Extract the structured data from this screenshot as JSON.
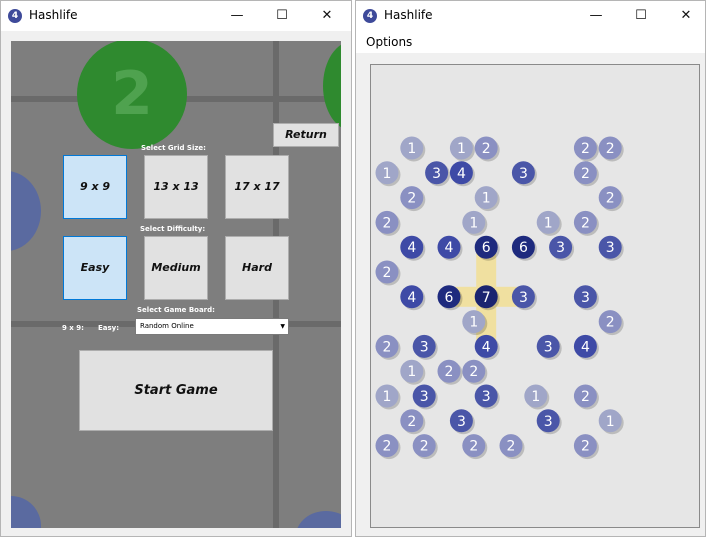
{
  "app_icon_text": "4",
  "left_window": {
    "title": "Hashlife",
    "controls": {
      "minimize": "—",
      "maximize": "☐",
      "close": "✕"
    },
    "return_label": "Return",
    "select_grid_size_label": "Select Grid Size:",
    "grid_sizes": [
      "9 x 9",
      "13 x 13",
      "17 x 17"
    ],
    "select_difficulty_label": "Select Difficulty:",
    "difficulties": [
      "Easy",
      "Medium",
      "Hard"
    ],
    "select_board_label": "Select Game Board:",
    "current_size": "9 x 9:",
    "current_difficulty": "Easy:",
    "board_dropdown_value": "Random Online",
    "start_label": "Start Game",
    "background_circle_number": "2"
  },
  "right_window": {
    "title": "Hashlife",
    "controls": {
      "minimize": "—",
      "maximize": "☐",
      "close": "✕"
    },
    "menu": [
      "Options"
    ]
  },
  "colors": {
    "node_1": "#a0a6c8",
    "node_2": "#8a90c2",
    "node_3": "#4a56a8",
    "node_4": "#3e4aa6",
    "node_6": "#1e2a7e",
    "node_7": "#1a2470",
    "bridge_highlight": "#f0e0a0",
    "selected_button": "#cce4f7"
  },
  "board": {
    "nodes": [
      {
        "n": "1",
        "c": 2,
        "r": 0
      },
      {
        "n": "1",
        "c": 6,
        "r": 0
      },
      {
        "n": "2",
        "c": 8,
        "r": 0
      },
      {
        "n": "2",
        "c": 16,
        "r": 0
      },
      {
        "n": "2",
        "c": 18,
        "r": 0
      },
      {
        "n": "1",
        "c": 0,
        "r": 1
      },
      {
        "n": "3",
        "c": 4,
        "r": 1
      },
      {
        "n": "4",
        "c": 6,
        "r": 1
      },
      {
        "n": "3",
        "c": 11,
        "r": 1
      },
      {
        "n": "2",
        "c": 16,
        "r": 1
      },
      {
        "n": "2",
        "c": 2,
        "r": 2
      },
      {
        "n": "1",
        "c": 8,
        "r": 2
      },
      {
        "n": "2",
        "c": 18,
        "r": 2
      },
      {
        "n": "2",
        "c": 0,
        "r": 3
      },
      {
        "n": "1",
        "c": 7,
        "r": 3
      },
      {
        "n": "1",
        "c": 13,
        "r": 3
      },
      {
        "n": "2",
        "c": 16,
        "r": 3
      },
      {
        "n": "4",
        "c": 2,
        "r": 4
      },
      {
        "n": "4",
        "c": 5,
        "r": 4
      },
      {
        "n": "6",
        "c": 8,
        "r": 4
      },
      {
        "n": "6",
        "c": 11,
        "r": 4
      },
      {
        "n": "3",
        "c": 14,
        "r": 4
      },
      {
        "n": "3",
        "c": 18,
        "r": 4
      },
      {
        "n": "2",
        "c": 0,
        "r": 5
      },
      {
        "n": "4",
        "c": 2,
        "r": 6
      },
      {
        "n": "6",
        "c": 5,
        "r": 6
      },
      {
        "n": "7",
        "c": 8,
        "r": 6
      },
      {
        "n": "3",
        "c": 11,
        "r": 6
      },
      {
        "n": "3",
        "c": 16,
        "r": 6
      },
      {
        "n": "1",
        "c": 7,
        "r": 7
      },
      {
        "n": "2",
        "c": 18,
        "r": 7
      },
      {
        "n": "2",
        "c": 0,
        "r": 8
      },
      {
        "n": "3",
        "c": 3,
        "r": 8
      },
      {
        "n": "4",
        "c": 8,
        "r": 8
      },
      {
        "n": "3",
        "c": 13,
        "r": 8
      },
      {
        "n": "4",
        "c": 16,
        "r": 8
      },
      {
        "n": "1",
        "c": 2,
        "r": 9
      },
      {
        "n": "2",
        "c": 5,
        "r": 9
      },
      {
        "n": "2",
        "c": 7,
        "r": 9
      },
      {
        "n": "1",
        "c": 0,
        "r": 10
      },
      {
        "n": "3",
        "c": 3,
        "r": 10
      },
      {
        "n": "3",
        "c": 8,
        "r": 10
      },
      {
        "n": "1",
        "c": 12,
        "r": 10
      },
      {
        "n": "2",
        "c": 16,
        "r": 10
      },
      {
        "n": "2",
        "c": 2,
        "r": 11
      },
      {
        "n": "3",
        "c": 6,
        "r": 11
      },
      {
        "n": "3",
        "c": 13,
        "r": 11
      },
      {
        "n": "1",
        "c": 18,
        "r": 11
      },
      {
        "n": "2",
        "c": 0,
        "r": 12
      },
      {
        "n": "2",
        "c": 3,
        "r": 12
      },
      {
        "n": "2",
        "c": 7,
        "r": 12
      },
      {
        "n": "2",
        "c": 10,
        "r": 12
      },
      {
        "n": "2",
        "c": 16,
        "r": 12
      }
    ]
  }
}
